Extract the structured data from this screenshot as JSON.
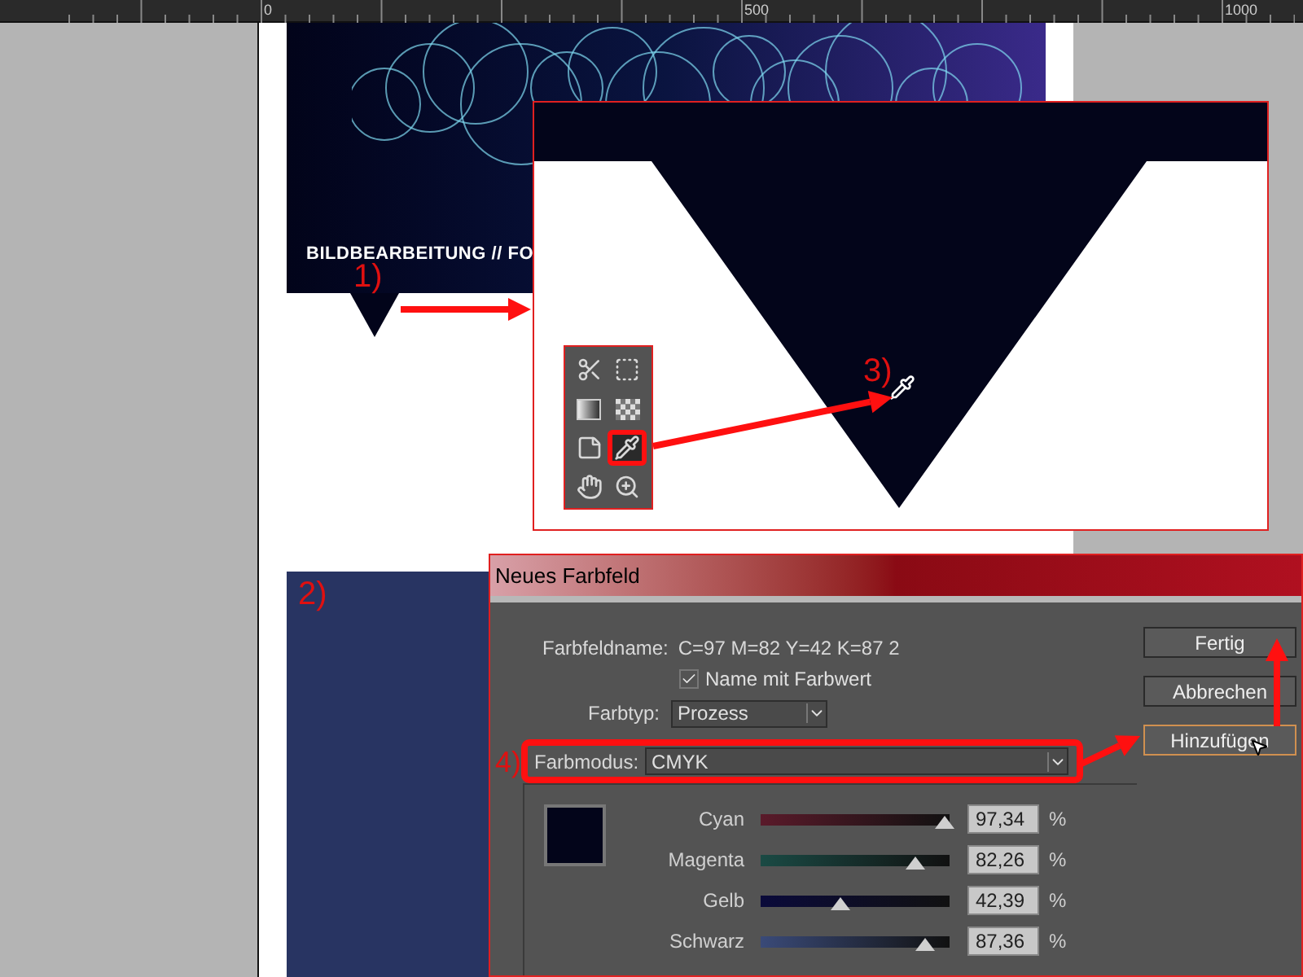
{
  "ruler": {
    "labels": [
      "0",
      "500",
      "1000"
    ]
  },
  "page": {
    "banner_title": "BILDBEARBEITUNG // FO"
  },
  "annotations": [
    "1)",
    "2)",
    "3)",
    "4)"
  ],
  "tools": [
    {
      "kind": "scissors",
      "selected": false
    },
    {
      "kind": "select",
      "selected": false
    },
    {
      "kind": "gradient",
      "selected": false
    },
    {
      "kind": "feather",
      "selected": false
    },
    {
      "kind": "note",
      "selected": false
    },
    {
      "kind": "eyedropper",
      "selected": true
    },
    {
      "kind": "hand",
      "selected": false
    },
    {
      "kind": "zoom",
      "selected": false
    }
  ],
  "dialog": {
    "title": "Neues Farbfeld",
    "name_label": "Farbfeldname:",
    "name_value": "C=97 M=82 Y=42 K=87 2",
    "name_with_value": {
      "label": "Name mit Farbwert",
      "checked": true
    },
    "color_type": {
      "label": "Farbtyp:",
      "value": "Prozess"
    },
    "color_mode": {
      "label": "Farbmodus:",
      "value": "CMYK"
    },
    "buttons": [
      {
        "label": "Fertig",
        "focused": false
      },
      {
        "label": "Abbrechen",
        "focused": false
      },
      {
        "label": "Hinzufügen",
        "focused": true
      }
    ],
    "channels": [
      {
        "name": "Cyan",
        "level": 0.9734,
        "value": "97,34",
        "unit": "%",
        "color": "#5a1a2a"
      },
      {
        "name": "Magenta",
        "level": 0.8226,
        "value": "82,26",
        "unit": "%",
        "color": "#1a4a44"
      },
      {
        "name": "Gelb",
        "level": 0.4239,
        "value": "42,39",
        "unit": "%",
        "color": "#0a0a3a"
      },
      {
        "name": "Schwarz",
        "level": 0.8736,
        "value": "87,36",
        "unit": "%",
        "color": "#3a4a78"
      }
    ]
  }
}
